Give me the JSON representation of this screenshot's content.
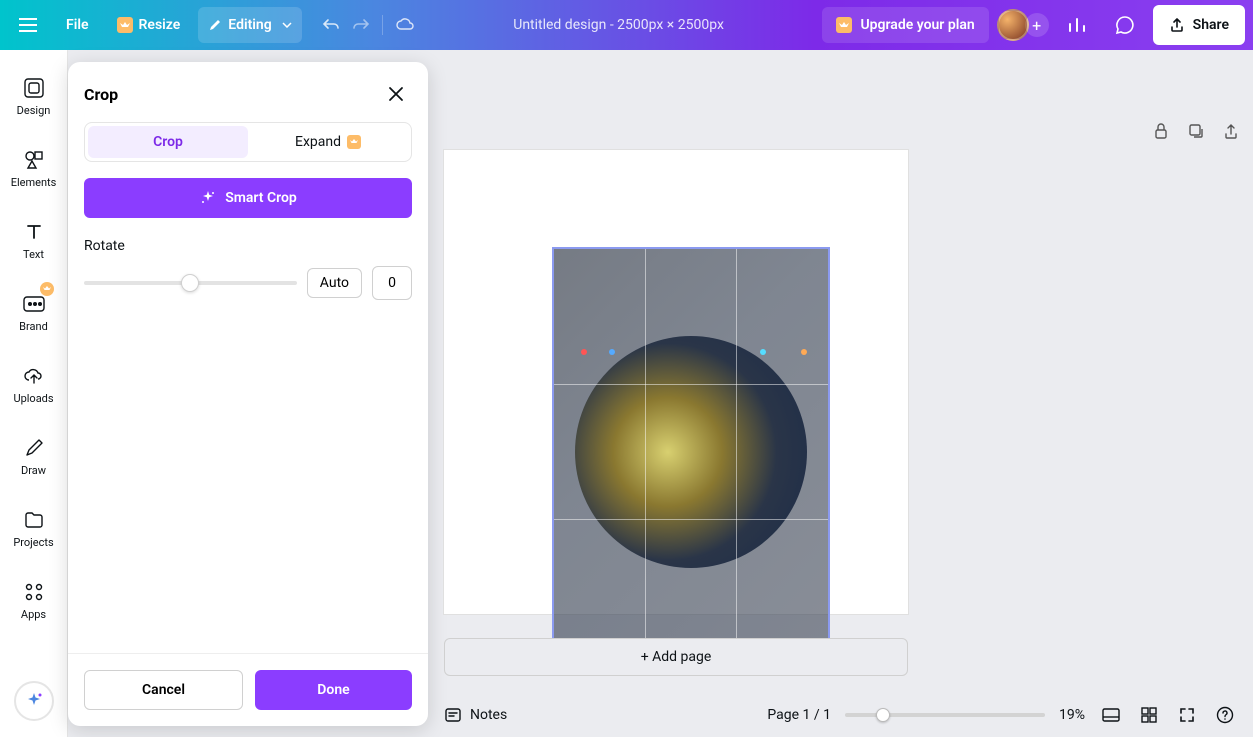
{
  "topbar": {
    "file": "File",
    "resize": "Resize",
    "editing": "Editing",
    "doc_title": "Untitled design - 2500px × 2500px",
    "upgrade": "Upgrade your plan",
    "share": "Share"
  },
  "sidebar": {
    "items": [
      {
        "label": "Design"
      },
      {
        "label": "Elements"
      },
      {
        "label": "Text"
      },
      {
        "label": "Brand"
      },
      {
        "label": "Uploads"
      },
      {
        "label": "Draw"
      },
      {
        "label": "Projects"
      },
      {
        "label": "Apps"
      }
    ]
  },
  "crop_panel": {
    "title": "Crop",
    "tab_crop": "Crop",
    "tab_expand": "Expand",
    "smart_crop": "Smart Crop",
    "rotate_label": "Rotate",
    "auto": "Auto",
    "rotate_value": "0",
    "cancel": "Cancel",
    "done": "Done"
  },
  "canvas": {
    "add_page": "+ Add page"
  },
  "bottombar": {
    "notes": "Notes",
    "page_indicator": "Page 1 / 1",
    "zoom_pct": "19%"
  },
  "colors": {
    "accent": "#8b3dff"
  }
}
